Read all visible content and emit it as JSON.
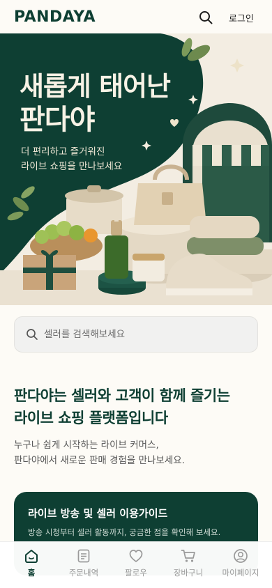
{
  "header": {
    "logo": "PANDAYA",
    "login_label": "로그인"
  },
  "hero": {
    "title_line1": "새롭게 태어난",
    "title_line2": "판다야",
    "subtitle_line1": "더 편리하고 즐거워진",
    "subtitle_line2": "라이브 쇼핑을 만나보세요"
  },
  "search": {
    "placeholder": "셀러를 검색해보세요"
  },
  "intro": {
    "title_line1": "판다야는 셀러와 고객이 함께 즐기는",
    "title_line2": "라이브 쇼핑 플랫폼입니다",
    "desc_line1": "누구나 쉽게 시작하는 라이브 커머스,",
    "desc_line2": "판다야에서 새로운 판매 경험을 만나보세요."
  },
  "guide": {
    "title": "라이브 방송 및 셀러 이용가이드",
    "desc": "방송 시청부터 셀러 활동까지, 궁금한 점을 확인해 보세요."
  },
  "tabs": [
    {
      "label": "홈",
      "icon": "home-icon",
      "active": true
    },
    {
      "label": "주문내역",
      "icon": "receipt-icon",
      "active": false
    },
    {
      "label": "팔로우",
      "icon": "heart-icon",
      "active": false
    },
    {
      "label": "장바구니",
      "icon": "cart-icon",
      "active": false
    },
    {
      "label": "마이페이지",
      "icon": "user-icon",
      "active": false
    }
  ],
  "colors": {
    "brand": "#0E3F33",
    "background": "#FDFBF6",
    "muted_text": "#9A9A9A"
  }
}
